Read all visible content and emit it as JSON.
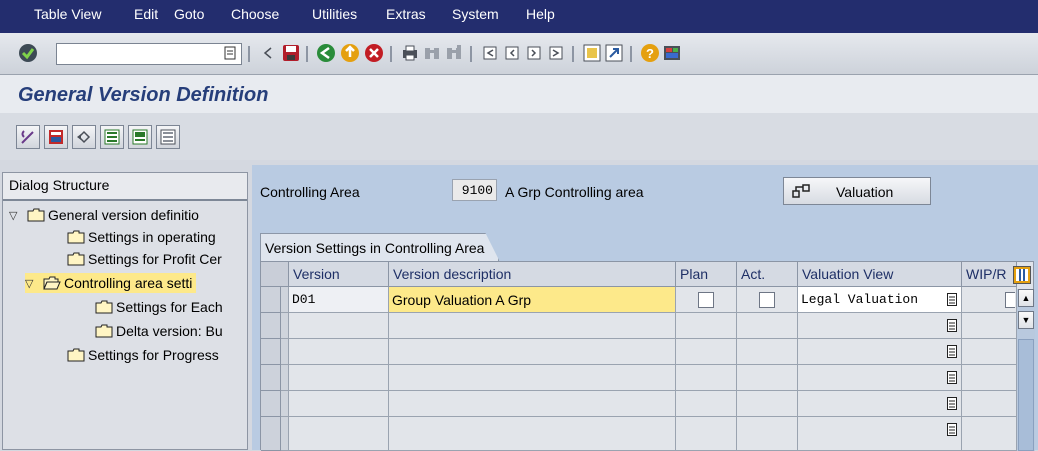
{
  "menu": [
    "Table View",
    "Edit",
    "Goto",
    "Choose",
    "Utilities",
    "Extras",
    "System",
    "Help"
  ],
  "toolbar": {
    "command_value": "",
    "icons": [
      "enter-icon",
      "command-field-dropdown-icon",
      "back-arrow-icon",
      "save-icon",
      "back-icon",
      "exit-icon",
      "cancel-icon",
      "print-icon",
      "find-icon",
      "find-next-icon",
      "first-page-icon",
      "previous-page-icon",
      "next-page-icon",
      "last-page-icon",
      "create-session-icon",
      "shortcut-icon",
      "help-icon",
      "layout-icon"
    ]
  },
  "page_title": "General Version Definition",
  "dialog_structure": {
    "heading": "Dialog Structure",
    "nodes": [
      {
        "label": "General version definitio",
        "level": 0,
        "expanded": true,
        "selected": false
      },
      {
        "label": "Settings in operating",
        "level": 1,
        "expanded": false,
        "selected": false
      },
      {
        "label": "Settings for Profit Cer",
        "level": 1,
        "expanded": false,
        "selected": false
      },
      {
        "label": "Controlling area setti",
        "level": 1,
        "expanded": true,
        "selected": true
      },
      {
        "label": "Settings for Each",
        "level": 2,
        "expanded": false,
        "selected": false
      },
      {
        "label": "Delta version: Bu",
        "level": 2,
        "expanded": false,
        "selected": false
      },
      {
        "label": "Settings for Progress",
        "level": 1,
        "expanded": false,
        "selected": false
      }
    ]
  },
  "header": {
    "controlling_area_label": "Controlling Area",
    "controlling_area_value": "9100",
    "controlling_area_desc": "A Grp Controlling area",
    "valuation_button": "Valuation"
  },
  "table": {
    "tab_label": "Version Settings in Controlling Area",
    "columns": [
      "Version",
      "Version description",
      "Plan",
      "Act.",
      "Valuation View",
      "WIP/R"
    ],
    "rows": [
      {
        "version": "D01",
        "description": "Group Valuation A Grp",
        "plan": false,
        "act": false,
        "valuation_view": "Legal Valuation",
        "wip": false
      },
      {
        "version": "",
        "description": "",
        "plan": null,
        "act": null,
        "valuation_view": "",
        "wip": null
      },
      {
        "version": "",
        "description": "",
        "plan": null,
        "act": null,
        "valuation_view": "",
        "wip": null
      },
      {
        "version": "",
        "description": "",
        "plan": null,
        "act": null,
        "valuation_view": "",
        "wip": null
      },
      {
        "version": "",
        "description": "",
        "plan": null,
        "act": null,
        "valuation_view": "",
        "wip": null
      },
      {
        "version": "",
        "description": "",
        "plan": null,
        "act": null,
        "valuation_view": "",
        "wip": null
      }
    ]
  },
  "colors": {
    "menubar": "#232d6e",
    "title": "#263e7a",
    "selected_row": "#fde98a",
    "pane_bg": "#b9cbe2"
  }
}
